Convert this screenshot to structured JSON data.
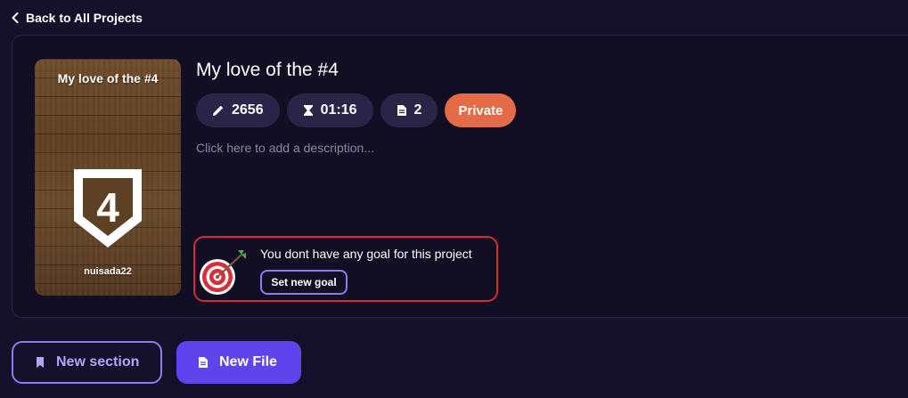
{
  "nav": {
    "back_label": "Back to All Projects"
  },
  "project": {
    "title": "My love of the #4",
    "cover": {
      "title": "My love of the #4",
      "badge_number": "4",
      "author": "nuisada22"
    },
    "stats": {
      "words": "2656",
      "time": "01:16",
      "files": "2",
      "visibility": "Private"
    },
    "description_placeholder": "Click here to add a description..."
  },
  "goal": {
    "message": "You dont have any goal for this project",
    "button_label": "Set new goal"
  },
  "actions": {
    "new_section_label": "New section",
    "new_file_label": "New File"
  },
  "colors": {
    "background": "#15112a",
    "card": "#120e24",
    "pill": "#2a2548",
    "private": "#e36b48",
    "accent": "#5f44ee",
    "accent_outline": "#8f7cf2",
    "highlight_border": "#d9282e"
  },
  "icons": {
    "back": "chevron-left-icon",
    "words": "pencil-icon",
    "time": "hourglass-icon",
    "files": "document-icon",
    "goal": "target-arrow-icon",
    "new_section": "bookmark-icon",
    "new_file": "file-icon"
  }
}
